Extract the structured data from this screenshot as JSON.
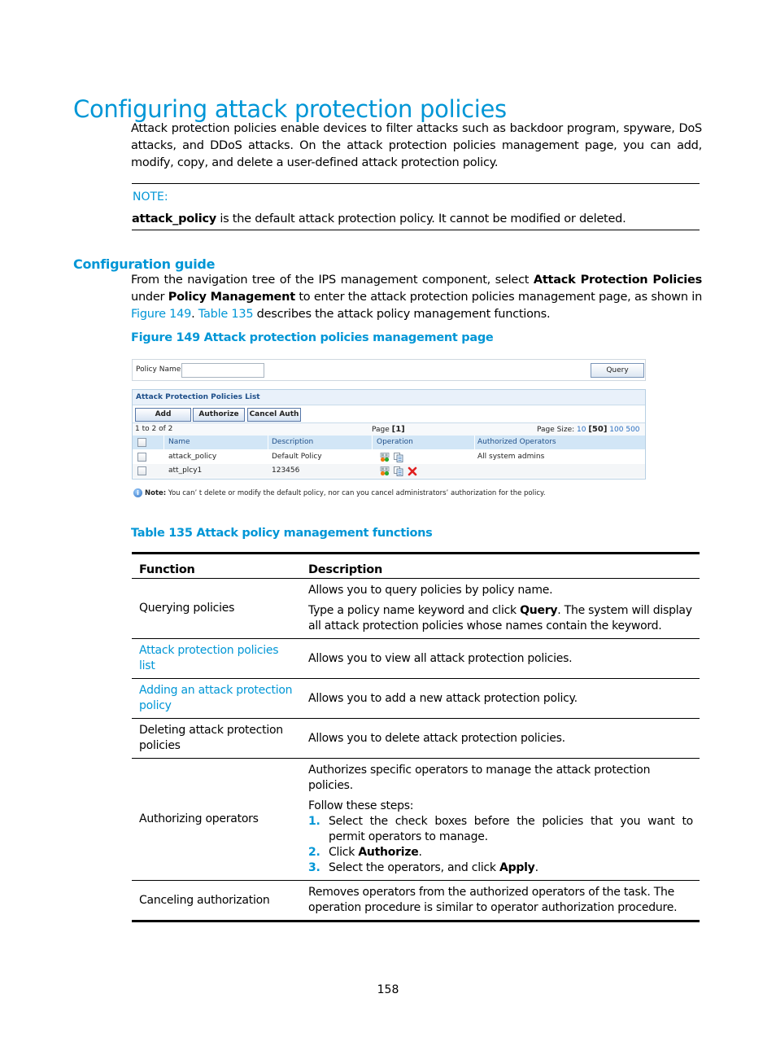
{
  "heading": "Configuring attack protection policies",
  "intro": "Attack protection policies enable devices to filter attacks such as backdoor program, spyware, DoS attacks, and DDoS attacks. On the attack protection policies management page, you can add, modify, copy, and delete a user-defined attack protection policy.",
  "note": {
    "label": "NOTE:",
    "bold": "attack_policy",
    "text": " is the default attack protection policy. It cannot be modified or deleted."
  },
  "section": {
    "title": "Configuration guide",
    "para": {
      "t1": "From the navigation tree of the IPS management component, select ",
      "b1": "Attack Protection Policies",
      "t2": " under ",
      "b2": "Policy Management",
      "t3": " to enter the attack protection policies management page, as shown in ",
      "link1": "Figure 149",
      "t4": ". ",
      "link2": "Table 135",
      "t5": " describes the attack policy management functions."
    }
  },
  "figure": {
    "caption": "Figure 149 Attack protection policies management page",
    "query": {
      "label": "Policy Name",
      "input_value": "",
      "button": "Query"
    },
    "list": {
      "title": "Attack Protection Policies List",
      "buttons": [
        "Add",
        "Authorize",
        "Cancel Auth"
      ],
      "range": "1 to 2 of 2",
      "page_label": "Page ",
      "page_current": "[1]",
      "page_size_label": "Page Size: ",
      "page_sizes": [
        "10",
        "[50]",
        "100",
        "500"
      ],
      "columns": [
        "Name",
        "Description",
        "Operation",
        "Authorized Operators"
      ],
      "rows": [
        {
          "name": "attack_policy",
          "description": "Default Policy",
          "operations": [
            "authorize-icon",
            "copy-icon"
          ],
          "operators": "All system admins"
        },
        {
          "name": "att_plcy1",
          "description": "123456",
          "operations": [
            "authorize-icon",
            "copy-icon",
            "delete-icon"
          ],
          "operators": ""
        }
      ]
    },
    "note": {
      "label": "Note:",
      "text": " You can’ t delete or modify the default policy, nor can you cancel administrators’  authorization for the policy."
    }
  },
  "table": {
    "caption": "Table 135 Attack policy management functions",
    "headers": [
      "Function",
      "Description"
    ],
    "rows": [
      {
        "function": "Querying policies",
        "link": false,
        "desc1": "Allows you to query policies by policy name.",
        "desc2_a": "Type a policy name keyword and click ",
        "desc2_b": "Query",
        "desc2_c": ". The system will display all attack protection policies whose names contain the keyword."
      },
      {
        "function": "Attack protection policies list",
        "link": true,
        "desc": "Allows you to view all attack protection policies."
      },
      {
        "function": "Adding an attack protection policy",
        "link": true,
        "desc": "Allows you to add a new attack protection policy."
      },
      {
        "function": "Deleting attack protection policies",
        "link": false,
        "desc": "Allows you to delete attack protection policies."
      },
      {
        "function": "Authorizing operators",
        "link": false,
        "desc1": "Authorizes specific operators to manage the attack protection policies.",
        "desc2": "Follow these steps:",
        "steps": [
          {
            "num": "1.",
            "a": "Select the check boxes before the policies that you want to permit operators to manage.",
            "b": "",
            "c": ""
          },
          {
            "num": "2.",
            "a": "Click ",
            "b": "Authorize",
            "c": "."
          },
          {
            "num": "3.",
            "a": "Select the operators, and click ",
            "b": "Apply",
            "c": "."
          }
        ]
      },
      {
        "function": "Canceling authorization",
        "link": false,
        "desc": "Removes operators from the authorized operators of the task. The operation procedure is similar to operator authorization procedure."
      }
    ]
  },
  "page_number": "158",
  "colors": {
    "accent": "#0096d6",
    "ui_header": "#d2e6f6",
    "ui_title": "#1e4f8a",
    "delete_red": "#e02020"
  }
}
